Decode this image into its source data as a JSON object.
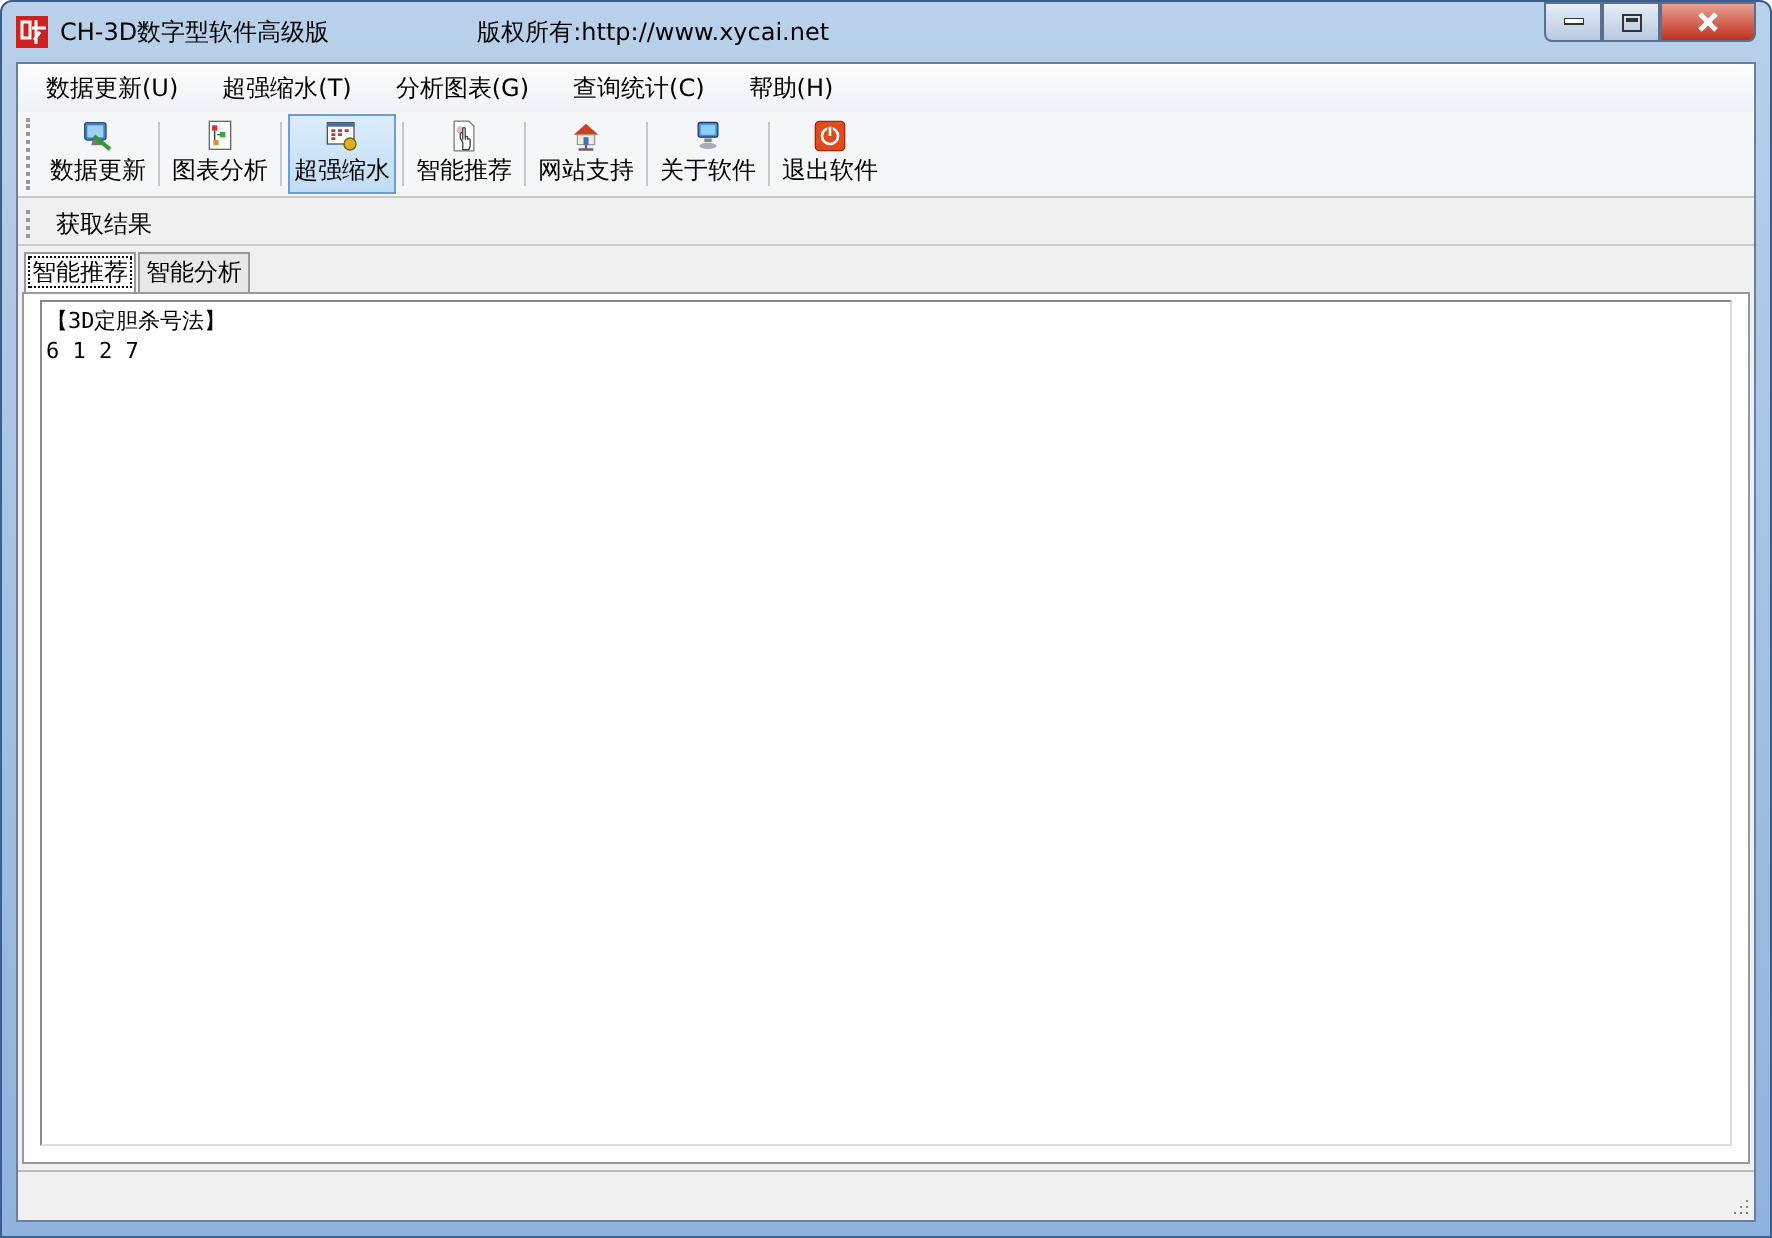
{
  "window": {
    "title": "CH-3D数字型软件高级版",
    "copyright": "版权所有:http://www.xycai.net"
  },
  "menu": [
    "数据更新(U)",
    "超强缩水(T)",
    "分析图表(G)",
    "查询统计(C)",
    "帮助(H)"
  ],
  "toolbar": [
    {
      "label": "数据更新",
      "kind": "monitor",
      "selected": false
    },
    {
      "label": "图表分析",
      "kind": "chart",
      "selected": false
    },
    {
      "label": "超强缩水",
      "kind": "grid",
      "selected": true
    },
    {
      "label": "智能推荐",
      "kind": "hand",
      "selected": false
    },
    {
      "label": "网站支持",
      "kind": "house",
      "selected": false
    },
    {
      "label": "关于软件",
      "kind": "computer",
      "selected": false
    },
    {
      "label": "退出软件",
      "kind": "power",
      "selected": false
    }
  ],
  "action_bar": [
    "获取结果"
  ],
  "tabs": [
    {
      "label": "智能推荐",
      "selected": true
    },
    {
      "label": "智能分析",
      "selected": false
    }
  ],
  "output": [
    "【3D定胆杀号法】",
    "6 1 2 7"
  ]
}
